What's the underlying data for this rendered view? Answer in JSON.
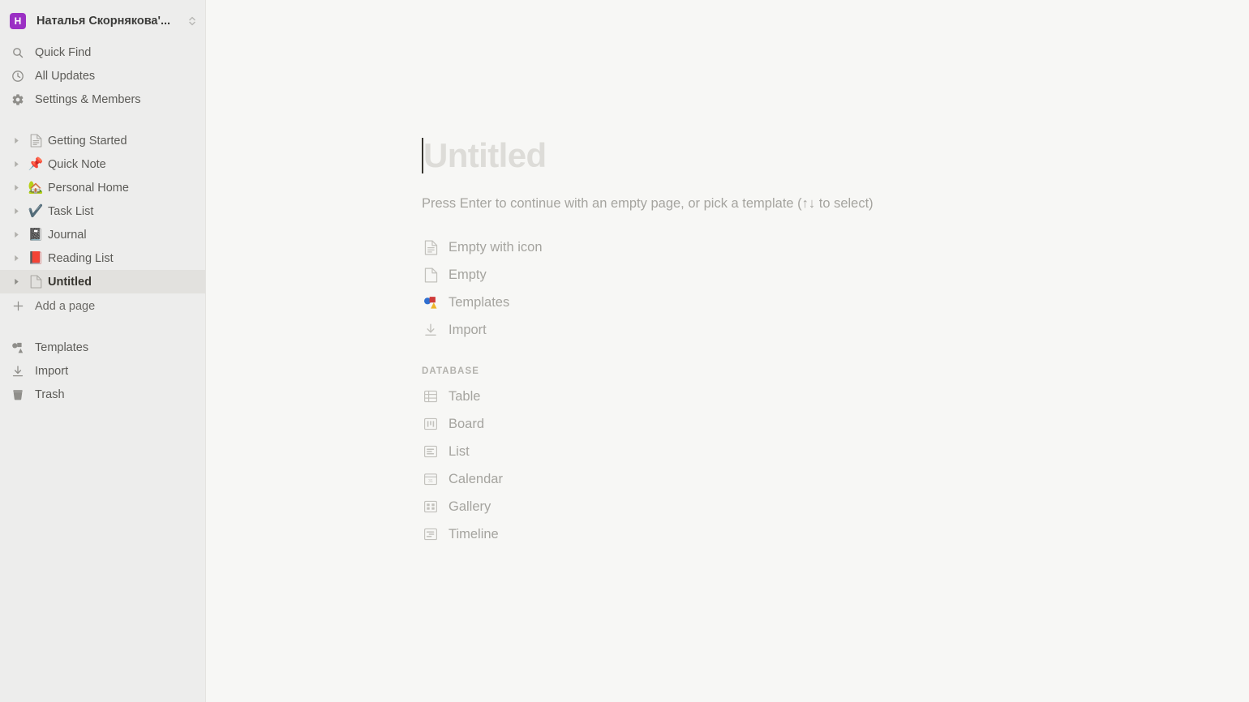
{
  "sidebar": {
    "workspace": {
      "avatar_letter": "H",
      "avatar_color": "#9b30c4",
      "name": "Наталья Скорнякова'...",
      "switcher_icon": "chevron-up-down-icon"
    },
    "nav": [
      {
        "label": "Quick Find",
        "icon": "search-icon"
      },
      {
        "label": "All Updates",
        "icon": "clock-icon"
      },
      {
        "label": "Settings & Members",
        "icon": "gear-icon"
      }
    ],
    "pages": [
      {
        "label": "Getting Started",
        "emoji": "",
        "icon": "document-lines-icon",
        "selected": false
      },
      {
        "label": "Quick Note",
        "emoji": "📌",
        "icon": "pushpin-emoji",
        "selected": false
      },
      {
        "label": "Personal Home",
        "emoji": "🏡",
        "icon": "house-with-garden-emoji",
        "selected": false
      },
      {
        "label": "Task List",
        "emoji": "✔️",
        "icon": "check-mark-emoji",
        "selected": false
      },
      {
        "label": "Journal",
        "emoji": "📓",
        "icon": "notebook-emoji",
        "selected": false
      },
      {
        "label": "Reading List",
        "emoji": "📕",
        "icon": "closed-book-emoji",
        "selected": false
      },
      {
        "label": "Untitled",
        "emoji": "",
        "icon": "document-blank-icon",
        "selected": true
      }
    ],
    "add_page": {
      "label": "Add a page",
      "icon": "plus-icon"
    },
    "bottom": [
      {
        "label": "Templates",
        "icon": "templates-icon"
      },
      {
        "label": "Import",
        "icon": "import-download-icon"
      },
      {
        "label": "Trash",
        "icon": "trash-icon"
      }
    ]
  },
  "main": {
    "title_placeholder": "Untitled",
    "hint": "Press Enter to continue with an empty page, or pick a template (↑↓ to select)",
    "options": [
      {
        "label": "Empty with icon",
        "icon": "document-lines-icon"
      },
      {
        "label": "Empty",
        "icon": "document-blank-icon"
      },
      {
        "label": "Templates",
        "icon": "templates-color-icon"
      },
      {
        "label": "Import",
        "icon": "import-download-icon"
      }
    ],
    "database_section_label": "DATABASE",
    "database_options": [
      {
        "label": "Table",
        "icon": "table-icon"
      },
      {
        "label": "Board",
        "icon": "board-icon"
      },
      {
        "label": "List",
        "icon": "list-icon"
      },
      {
        "label": "Calendar",
        "icon": "calendar-icon"
      },
      {
        "label": "Gallery",
        "icon": "gallery-icon"
      },
      {
        "label": "Timeline",
        "icon": "timeline-icon"
      }
    ]
  },
  "colors": {
    "sidebar_bg": "#ededec",
    "main_bg": "#f7f7f5",
    "selected_row_bg": "#e2e1de",
    "accent_purple": "#9b30c4",
    "text_primary": "#37352f",
    "text_muted": "#a5a49f"
  }
}
